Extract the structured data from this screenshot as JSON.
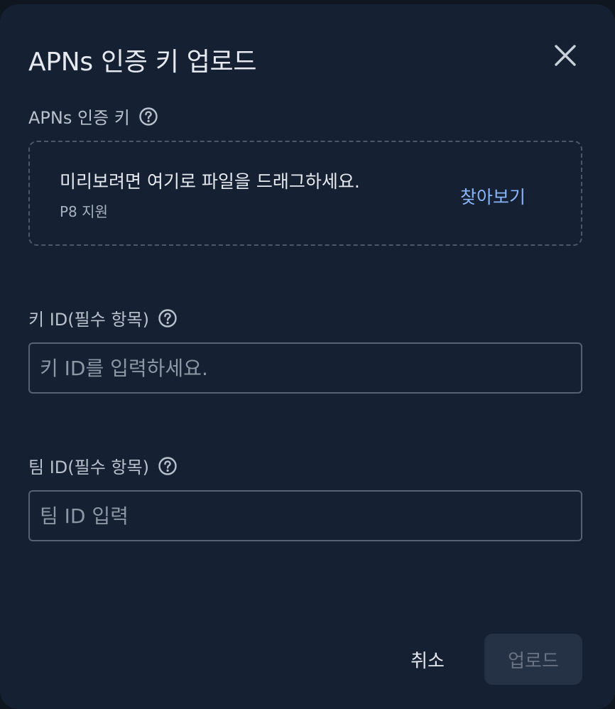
{
  "dialog": {
    "title": "APNs 인증 키 업로드",
    "close_icon": "close-icon"
  },
  "auth_key": {
    "label": "APNs 인증 키",
    "help_icon": "help-circle-icon",
    "dropzone": {
      "main_text": "미리보려면 여기로 파일을 드래그하세요.",
      "sub_text": "P8 지원",
      "browse_label": "찾아보기"
    }
  },
  "key_id": {
    "label": "키 ID(필수 항목)",
    "help_icon": "help-circle-icon",
    "placeholder": "키 ID를 입력하세요.",
    "value": ""
  },
  "team_id": {
    "label": "팀 ID(필수 항목)",
    "help_icon": "help-circle-icon",
    "placeholder": "팀 ID 입력",
    "value": ""
  },
  "actions": {
    "cancel_label": "취소",
    "upload_label": "업로드",
    "upload_disabled": true
  },
  "colors": {
    "background": "#152132",
    "accent_link": "#8ab4f8",
    "text_primary": "#e6eaf0",
    "text_secondary": "#b9c1cc",
    "disabled_button_bg": "#253245"
  }
}
